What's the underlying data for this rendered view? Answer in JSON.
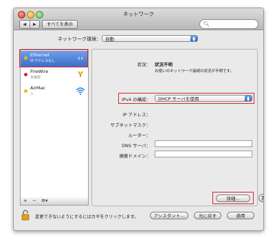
{
  "window": {
    "title": "ネットワーク"
  },
  "toolbar": {
    "back": "◀",
    "forward": "▶",
    "show_all": "すべてを表示",
    "search_icon": "magnifier"
  },
  "location": {
    "label": "ネットワーク環境：",
    "value": "自動"
  },
  "services": [
    {
      "name": "Ethernet",
      "status": "IP アドレスなし",
      "status_color": "#f5b800",
      "icon": "ethernet-arrows"
    },
    {
      "name": "FireWire",
      "status": "未接続",
      "status_color": "#d6232f",
      "icon": "firewire-y"
    },
    {
      "name": "AirMac",
      "status": "入",
      "status_color": "#f5b800",
      "icon": "wifi"
    }
  ],
  "sidebar_footer": {
    "add": "+",
    "remove": "−",
    "gear": "✲▾"
  },
  "detail": {
    "status_label": "状況：",
    "status_value": "状況不明",
    "status_desc": "お使いのネットワーク接続の状況が不明です。",
    "ipv4_label": "IPv4 の構成：",
    "ipv4_value": "DHCP サーバを使用",
    "ip_label": "IP アドレス：",
    "subnet_label": "サブネットマスク：",
    "router_label": "ルーター：",
    "dns_label": "DNS サーバ：",
    "search_domain_label": "検索ドメイン：",
    "advanced_button": "詳細...",
    "help": "?"
  },
  "footer": {
    "lock_message": "変更できないようにするにはカギをクリックします。",
    "assistant": "アシスタント...",
    "revert": "元に戻す",
    "apply": "適用"
  },
  "colors": {
    "highlight": "#d6232f",
    "selection": "#3d6fca",
    "accent": "#2d63c8"
  }
}
